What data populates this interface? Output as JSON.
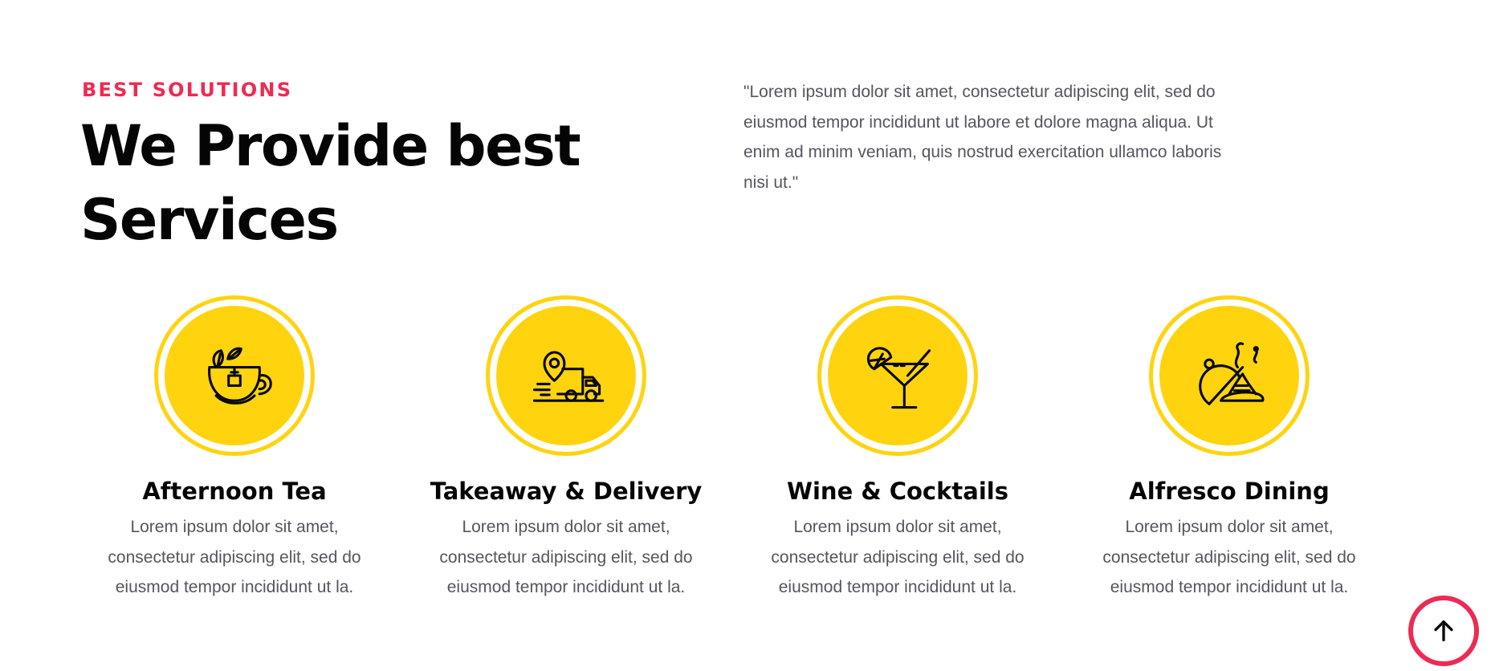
{
  "section": {
    "eyebrow": "BEST SOLUTIONS",
    "title_line1": "We Provide best",
    "title_line2": "Services",
    "intro_line1": "\"Lorem ipsum dolor sit amet, consectetur adipiscing elit, sed do",
    "intro_line2": "eiusmod tempor incididunt ut labore et dolore magna aliqua. Ut",
    "intro_line3": "enim ad minim veniam, quis nostrud exercitation ullamco laboris",
    "intro_line4": "nisi ut.\""
  },
  "services": [
    {
      "icon": "tea-cup-icon",
      "title": "Afternoon Tea",
      "line1": "Lorem ipsum dolor sit amet,",
      "line2": "consectetur adipiscing elit, sed do",
      "line3": "eiusmod tempor incididunt ut la."
    },
    {
      "icon": "delivery-truck-icon",
      "title": "Takeaway & Delivery",
      "line1": "Lorem ipsum dolor sit amet,",
      "line2": "consectetur adipiscing elit, sed do",
      "line3": "eiusmod tempor incididunt ut la."
    },
    {
      "icon": "cocktail-glass-icon",
      "title": "Wine & Cocktails",
      "line1": "Lorem ipsum dolor sit amet,",
      "line2": "consectetur adipiscing elit, sed do",
      "line3": "eiusmod tempor incididunt ut la."
    },
    {
      "icon": "food-plate-icon",
      "title": "Alfresco Dining",
      "line1": "Lorem ipsum dolor sit amet,",
      "line2": "consectetur adipiscing elit, sed do",
      "line3": "eiusmod tempor incididunt ut la."
    }
  ],
  "scroll_top": {
    "icon": "arrow-up-icon"
  },
  "colors": {
    "accent": "#ec2b54",
    "badge_yellow": "#ffd40f",
    "heading": "#050505",
    "body_text": "#55555f"
  }
}
